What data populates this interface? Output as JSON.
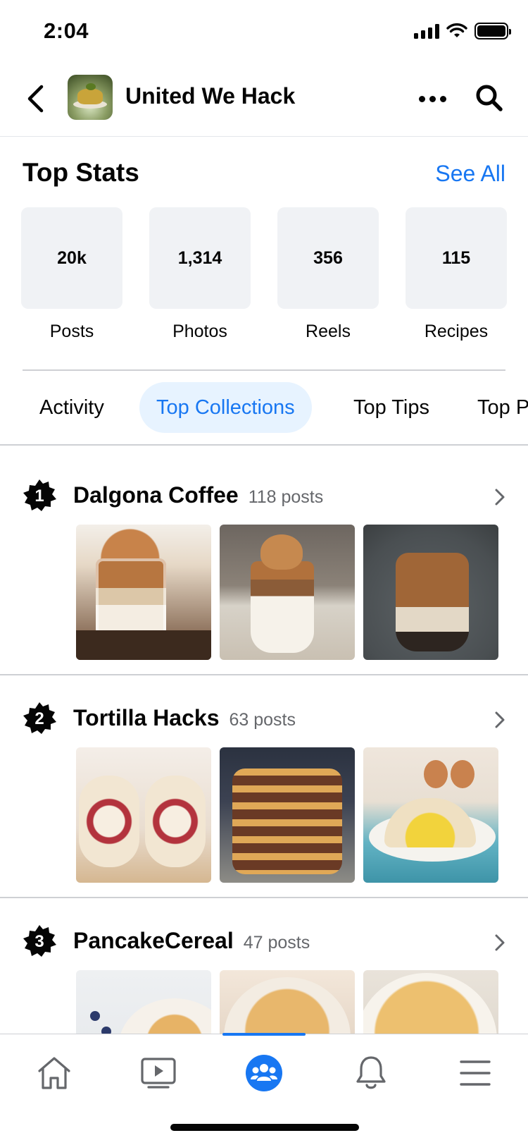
{
  "status_bar": {
    "time": "2:04"
  },
  "header": {
    "group_name": "United We Hack"
  },
  "top_stats": {
    "title": "Top Stats",
    "see_all": "See All",
    "items": [
      {
        "value": "20k",
        "label": "Posts"
      },
      {
        "value": "1,314",
        "label": "Photos"
      },
      {
        "value": "356",
        "label": "Reels"
      },
      {
        "value": "115",
        "label": "Recipes"
      }
    ]
  },
  "tabs": [
    {
      "label": "Activity",
      "active": false
    },
    {
      "label": "Top Collections",
      "active": true
    },
    {
      "label": "Top Tips",
      "active": false
    },
    {
      "label": "Top P",
      "active": false
    }
  ],
  "collections": [
    {
      "rank": "1",
      "name": "Dalgona Coffee",
      "count": "118 posts"
    },
    {
      "rank": "2",
      "name": "Tortilla Hacks",
      "count": "63 posts"
    },
    {
      "rank": "3",
      "name": "PancakeCereal",
      "count": "47 posts"
    }
  ],
  "bottom_nav": {
    "items": [
      "home-icon",
      "video-icon",
      "groups-icon",
      "bell-icon",
      "menu-icon"
    ],
    "active": "groups-icon"
  },
  "colors": {
    "accent": "#1877f2",
    "active_tab_bg": "#e7f3ff",
    "stat_box_bg": "#f0f2f5",
    "secondary_text": "#65676b"
  }
}
